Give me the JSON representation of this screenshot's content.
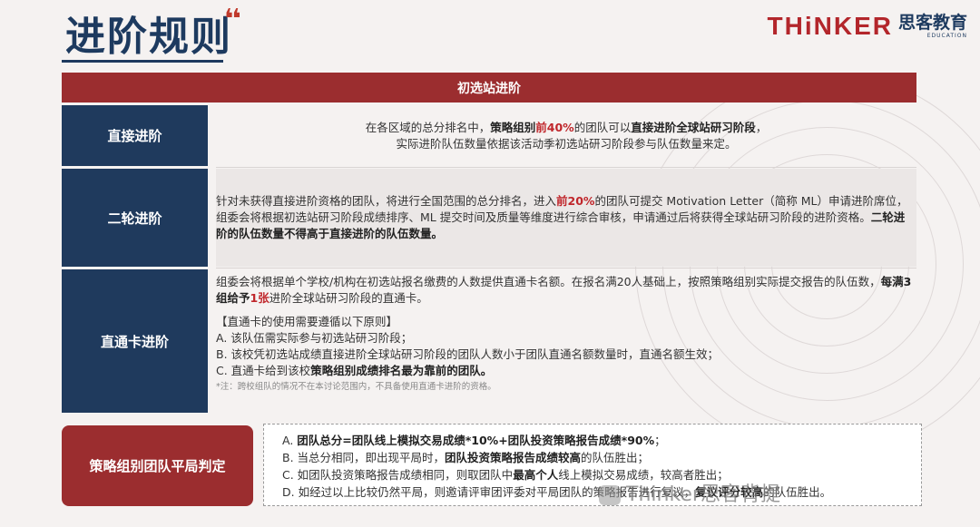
{
  "page_title": "进阶规则",
  "logo": {
    "en": "THiNKER",
    "cn": "思客教育",
    "sub": "EDUCATION"
  },
  "section_header": "初选站进阶",
  "rows": [
    {
      "label": "直接进阶",
      "line1_a": "在各区域的总分排名中，",
      "line1_b": "策略组别",
      "line1_c": "前40%",
      "line1_d": "的团队可以",
      "line1_e": "直接进阶全球站研习阶段",
      "line1_f": "，",
      "line2": "实际进阶队伍数量依据该活动季初选站研习阶段参与队伍数量来定。"
    },
    {
      "label": "二轮进阶",
      "p_a": "针对未获得直接进阶资格的团队，将进行全国范围的总分排名，进入",
      "p_b": "前20%",
      "p_c": "的团队可提交 Motivation Letter（简称 ML）申请进阶席位，组委会将根据初选站研习阶段成绩排序、ML 提交时间及质量等维度进行综合审核，申请通过后将获得全球站研习阶段的进阶资格。",
      "p_d": "二轮进阶的队伍数量不得高于直接进阶的队伍数量。"
    },
    {
      "label": "直通卡进阶",
      "p_a": "组委会将根据单个学校/机构在初选站报名缴费的人数提供直通卡名额。在报名满20人基础上，按照策略组别实际提交报告的队伍数，",
      "p_b": "每满3组给予",
      "p_c": "1张",
      "p_d": "进阶全球站研习阶段的直通卡。",
      "rules_title": "【直通卡的使用需要遵循以下原则】",
      "rule_a": "A. 该队伍需实际参与初选站研习阶段；",
      "rule_b": "B. 该校凭初选站成绩直接进阶全球站研习阶段的团队人数小于团队直通名额数量时，直通名额生效；",
      "rule_c_a": "C. 直通卡给到该校",
      "rule_c_b": "策略组别成绩排名最为靠前的团队。",
      "note": "*注：跨校组队的情况不在本讨论范围内，不具备使用直通卡进阶的资格。"
    }
  ],
  "strategy": {
    "label": "策略组别团队平局判定",
    "a_a": "A. ",
    "a_b": "团队总分=团队线上模拟交易成绩*10%+团队投资策略报告成绩*90%",
    "a_c": "；",
    "b_a": "B. 当总分相同，即出现平局时，",
    "b_b": "团队投资策略报告成绩较高",
    "b_c": "的队伍胜出；",
    "c_a": "C. 如团队投资策略报告成绩相同，则取团队中",
    "c_b": "最高个人",
    "c_c": "线上模拟交易成绩，较高者胜出；",
    "d_a": "D. 如经过以上比较仍然平局，则邀请评审团评委对平局团队的策略报告进行复议，",
    "d_b": "复议评分较高",
    "d_c": "的队伍胜出。"
  },
  "watermark": "Thinker思客背提"
}
